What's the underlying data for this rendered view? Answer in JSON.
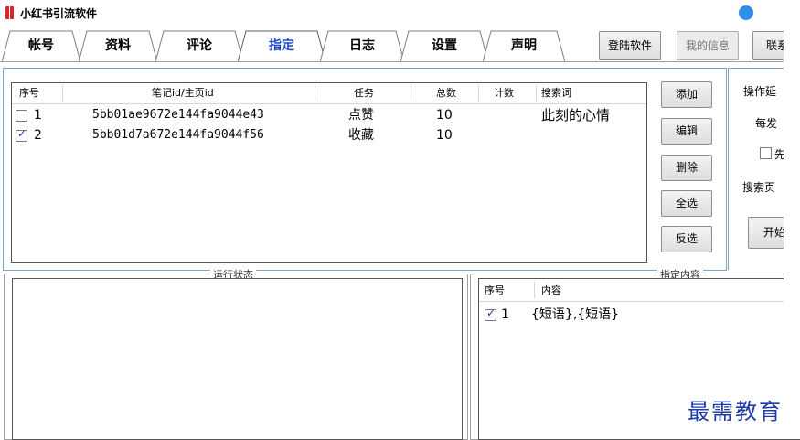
{
  "app": {
    "title": "小红书引流软件"
  },
  "tabs": [
    {
      "label": "帐号",
      "active": false
    },
    {
      "label": "资料",
      "active": false
    },
    {
      "label": "评论",
      "active": false
    },
    {
      "label": "指定",
      "active": true
    },
    {
      "label": "日志",
      "active": false
    },
    {
      "label": "设置",
      "active": false
    },
    {
      "label": "声明",
      "active": false
    }
  ],
  "top_buttons": {
    "login": "登陆软件",
    "my_info": "我的信息",
    "contact": "联系"
  },
  "task_table": {
    "headers": {
      "index": "序号",
      "note_id": "笔记id/主页id",
      "task": "任务",
      "total": "总数",
      "count": "计数",
      "keyword": "搜索词"
    },
    "rows": [
      {
        "index": "1",
        "checked": false,
        "note_id": "5bb01ae9672e144fa9044e43",
        "task": "点赞",
        "total": "10",
        "count": "",
        "keyword": "此刻的心情"
      },
      {
        "index": "2",
        "checked": true,
        "note_id": "5bb01d7a672e144fa9044f56",
        "task": "收藏",
        "total": "10",
        "count": "",
        "keyword": ""
      }
    ]
  },
  "side_buttons": {
    "add": "添加",
    "edit": "编辑",
    "delete": "删除",
    "select_all": "全选",
    "invert": "反选"
  },
  "right_panel": {
    "op_delay": "操作延",
    "each_send": "每发",
    "checkbox_label": "先",
    "search_page": "搜索页",
    "start": "开始"
  },
  "run_status": {
    "title": "运行状态"
  },
  "content_panel": {
    "title": "指定内容",
    "headers": {
      "index": "序号",
      "content": "内容"
    },
    "rows": [
      {
        "index": "1",
        "checked": true,
        "content": "{短语},{短语}"
      }
    ]
  },
  "watermark": "最需教育"
}
